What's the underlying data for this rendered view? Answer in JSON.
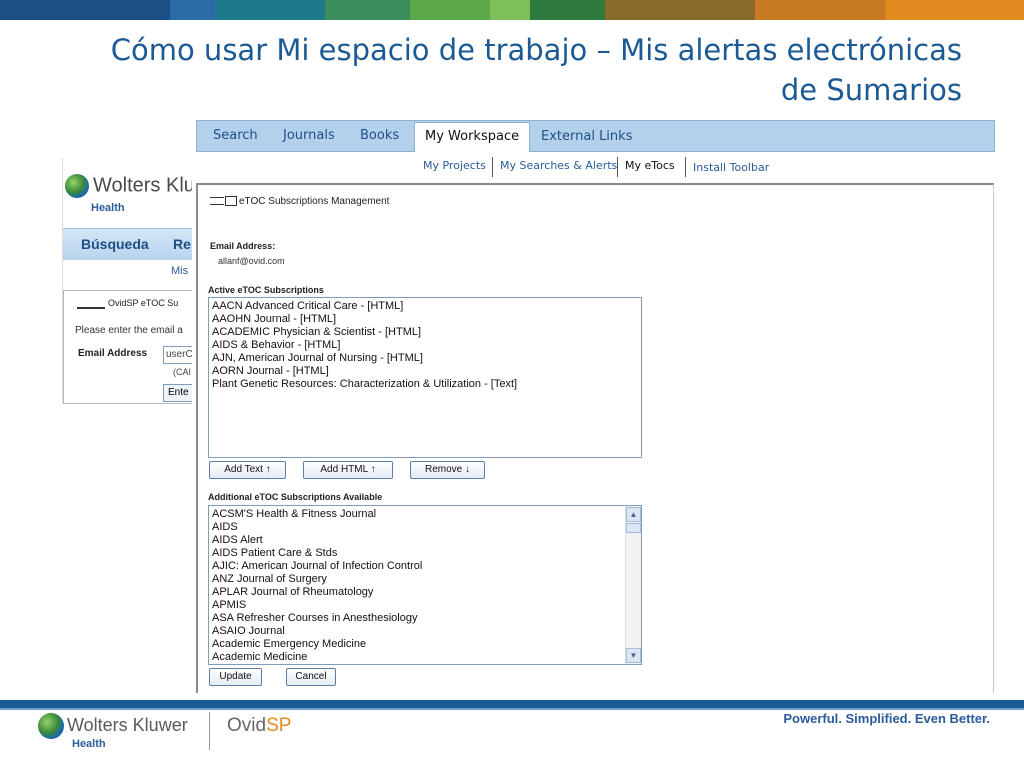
{
  "slide": {
    "title_line1": "Cómo usar Mi espacio de trabajo – Mis alertas electrónicas",
    "title_line2": "de Sumarios"
  },
  "banner": {
    "colors": [
      "#1b4f86",
      "#2a6aa6",
      "#1d7a8c",
      "#3a8e5e",
      "#5aa84a",
      "#7fbf5a",
      "#2f7b3e",
      "#8a6a2a",
      "#c87a22",
      "#e08a20"
    ]
  },
  "background_screenshot": {
    "logo_text": "Wolters Klu",
    "logo_sub": "Health",
    "tab_search": "Búsqueda",
    "tab_partial": "Re",
    "subnav_partial": "Mis",
    "etoc_title": "OvidSP eTOC Su",
    "please_text": "Please enter the email a",
    "email_label": "Email Address",
    "email_value": "userC",
    "caption": "(CAI",
    "enter_button": "Ente"
  },
  "nav": {
    "tabs": [
      "Search",
      "Journals",
      "Books",
      "My Workspace",
      "External Links"
    ],
    "active_tab": "My Workspace",
    "subnav": [
      "My Projects",
      "My Searches & Alerts",
      "My eTocs",
      "Install Toolbar"
    ],
    "active_subnav": "My eTocs"
  },
  "panel": {
    "title": "eTOC Subscriptions Management",
    "email_label": "Email Address:",
    "email_value": "allanf@ovid.com",
    "active_label": "Active eTOC Subscriptions",
    "active_items": [
      "AACN Advanced Critical Care - [HTML]",
      "AAOHN Journal - [HTML]",
      "ACADEMIC Physician & Scientist - [HTML]",
      "AIDS & Behavior - [HTML]",
      "AJN, American Journal of Nursing - [HTML]",
      "AORN Journal - [HTML]",
      "Plant Genetic Resources: Characterization & Utilization - [Text]"
    ],
    "btn_add_text": "Add Text ↑",
    "btn_add_html": "Add HTML ↑",
    "btn_remove": "Remove ↓",
    "available_label": "Additional eTOC Subscriptions Available",
    "available_items": [
      "ACSM'S Health & Fitness Journal",
      "AIDS",
      "AIDS Alert",
      "AIDS Patient Care & Stds",
      "AJIC: American Journal of Infection Control",
      "ANZ Journal of Surgery",
      "APLAR Journal of Rheumatology",
      "APMIS",
      "ASA Refresher Courses in Anesthesiology",
      "ASAIO Journal",
      "Academic Emergency Medicine",
      "Academic Medicine"
    ],
    "btn_update": "Update",
    "btn_cancel": "Cancel"
  },
  "footer": {
    "brand": "Wolters Kluwer",
    "brand_sub": "Health",
    "product_a": "Ovid",
    "product_b": "SP",
    "tagline": "Powerful. Simplified. Even Better."
  }
}
